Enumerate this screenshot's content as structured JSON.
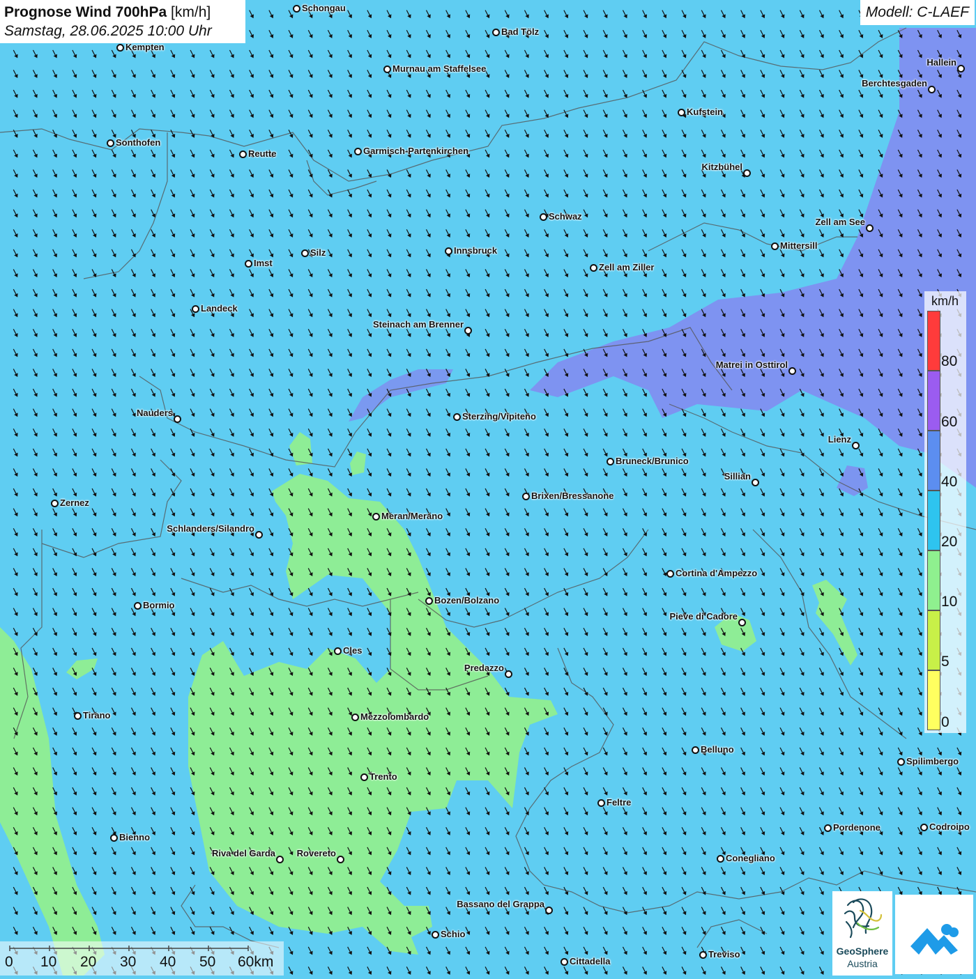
{
  "header": {
    "title_bold": "Prognose Wind 700hPa",
    "title_unit": "[km/h]",
    "datetime": "Samstag, 28.06.2025 10:00 Uhr",
    "model": "Modell: C-LAEF"
  },
  "colors": {
    "wind_lt_10": "#90ee90",
    "wind_10_20": "#5fcdf2",
    "wind_20_40": "#7f8ff0",
    "wind_40_60": "#9b7ff0",
    "wind_gt_60": "#ff4040",
    "borders": "#555555",
    "arrows": "#111111"
  },
  "legend": {
    "unit": "km/h",
    "ticks": [
      "80",
      "60",
      "40",
      "20",
      "10",
      "5",
      "0"
    ],
    "colors": [
      "#ff3b3b",
      "#9b5cf0",
      "#5c8ef0",
      "#2ec4ef",
      "#8ff08f",
      "#c8f048",
      "#ffff60"
    ]
  },
  "scalebar": {
    "labels": [
      "0",
      "10",
      "20",
      "30",
      "40",
      "50",
      "60km"
    ]
  },
  "logo": {
    "name": "GeoSphere",
    "sub": "Austria"
  },
  "map": {
    "wind_direction": "north-west",
    "cities": [
      {
        "name": "Schongau"
      },
      {
        "name": "Kempten"
      },
      {
        "name": "Bad Tölz"
      },
      {
        "name": "Murnau am Staffelsee"
      },
      {
        "name": "Hallein"
      },
      {
        "name": "Berchtesgaden"
      },
      {
        "name": "Kufstein"
      },
      {
        "name": "Sonthofen"
      },
      {
        "name": "Reutte"
      },
      {
        "name": "Garmisch-Partenkirchen"
      },
      {
        "name": "Kitzbühel"
      },
      {
        "name": "Schwaz"
      },
      {
        "name": "Zell am See"
      },
      {
        "name": "Mittersill"
      },
      {
        "name": "Silz"
      },
      {
        "name": "Innsbruck"
      },
      {
        "name": "Imst"
      },
      {
        "name": "Zell am Ziller"
      },
      {
        "name": "Landeck"
      },
      {
        "name": "Steinach am Brenner"
      },
      {
        "name": "Matrei in Osttirol"
      },
      {
        "name": "Nauders"
      },
      {
        "name": "Sterzing/Vipiteno"
      },
      {
        "name": "Lienz"
      },
      {
        "name": "Bruneck/Brunico"
      },
      {
        "name": "Sillian"
      },
      {
        "name": "Zernez"
      },
      {
        "name": "Brixen/Bressanone"
      },
      {
        "name": "Meran/Merano"
      },
      {
        "name": "Schlanders/Silandro"
      },
      {
        "name": "Cortina d'Ampezzo"
      },
      {
        "name": "Bormio"
      },
      {
        "name": "Bozen/Bolzano"
      },
      {
        "name": "Pieve di Cadore"
      },
      {
        "name": "Cles"
      },
      {
        "name": "Predazzo"
      },
      {
        "name": "Tirano"
      },
      {
        "name": "Mezzolombardo"
      },
      {
        "name": "Belluno"
      },
      {
        "name": "Spilimbergo"
      },
      {
        "name": "Trento"
      },
      {
        "name": "Feltre"
      },
      {
        "name": "Bienno"
      },
      {
        "name": "Pordenone"
      },
      {
        "name": "Codroipo"
      },
      {
        "name": "Riva del Garda"
      },
      {
        "name": "Rovereto"
      },
      {
        "name": "Conegliano"
      },
      {
        "name": "Bassano del Grappa"
      },
      {
        "name": "Schio"
      },
      {
        "name": "Treviso"
      },
      {
        "name": "Cittadella"
      }
    ]
  }
}
